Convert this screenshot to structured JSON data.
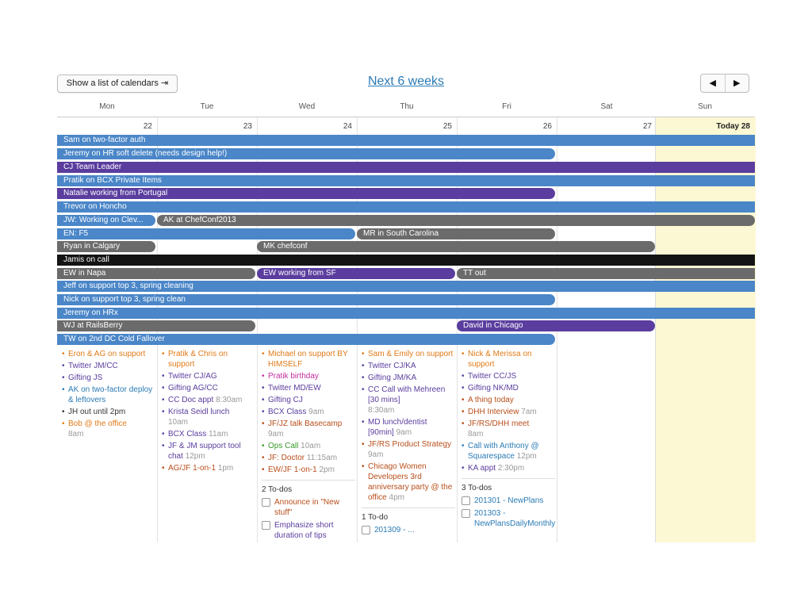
{
  "toolbar": {
    "calendars_button": "Show a list of calendars ⇥",
    "title": "Next 6 weeks",
    "prev": "◀",
    "next": "▶"
  },
  "days": [
    "Mon",
    "Tue",
    "Wed",
    "Thu",
    "Fri",
    "Sat",
    "Sun"
  ],
  "dates": [
    "22",
    "23",
    "24",
    "25",
    "26",
    "27",
    "Today 28"
  ],
  "events": [
    {
      "label": "Sam on two-factor auth",
      "color": "blue"
    },
    {
      "label": "Jeremy on HR soft delete (needs design help!)",
      "color": "blue"
    },
    {
      "label": "CJ Team Leader",
      "color": "purple"
    },
    {
      "label": "Pratik on BCX Private Items",
      "color": "blue"
    },
    {
      "label": "Natalie working from Portugal",
      "color": "purple"
    },
    {
      "label": "Trevor on Honcho",
      "color": "blue"
    },
    {
      "label": "JW: Working on Clev...",
      "color": "blue"
    },
    {
      "label": "AK at ChefConf2013",
      "color": "gray"
    },
    {
      "label": "EN: F5",
      "color": "blue"
    },
    {
      "label": "MR in South Carolina",
      "color": "gray"
    },
    {
      "label": "Ryan in Calgary",
      "color": "gray"
    },
    {
      "label": "MK chefconf",
      "color": "gray"
    },
    {
      "label": "Jamis on call",
      "color": "black"
    },
    {
      "label": "EW in Napa",
      "color": "gray"
    },
    {
      "label": "EW working from SF",
      "color": "purple"
    },
    {
      "label": "TT out",
      "color": "gray"
    },
    {
      "label": "Jeff on support top 3, spring cleaning",
      "color": "blue"
    },
    {
      "label": "Nick on support top 3, spring clean",
      "color": "blue"
    },
    {
      "label": "Jeremy on HRx",
      "color": "blue"
    },
    {
      "label": "WJ at RailsBerry",
      "color": "gray"
    },
    {
      "label": "David in Chicago",
      "color": "purple"
    },
    {
      "label": "TW on 2nd DC Cold Fallover",
      "color": "blue"
    }
  ],
  "mon_items": [
    {
      "t": "Eron & AG on support",
      "time": "",
      "color": "orange"
    },
    {
      "t": "Twitter JM/CC",
      "time": "",
      "color": "purple"
    },
    {
      "t": "Gifting JS",
      "time": "",
      "color": "purple"
    },
    {
      "t": "AK on two-factor deploy & leftovers",
      "time": "",
      "color": "blue"
    },
    {
      "t": "JH out until 2pm",
      "time": "",
      "color": "dark"
    },
    {
      "t": "Bob @ the office",
      "time": "8am",
      "color": "orange"
    }
  ],
  "tue_items": [
    {
      "t": "Pratik & Chris on support",
      "time": "",
      "color": "orange"
    },
    {
      "t": "Twitter CJ/AG",
      "time": "",
      "color": "purple"
    },
    {
      "t": "Gifting AG/CC",
      "time": "",
      "color": "purple"
    },
    {
      "t": "CC Doc appt",
      "time": "8:30am",
      "color": "purple"
    },
    {
      "t": "Krista Seidl lunch",
      "time": "10am",
      "color": "purple"
    },
    {
      "t": "BCX Class",
      "time": "11am",
      "color": "purple"
    },
    {
      "t": "JF & JM support tool chat",
      "time": "12pm",
      "color": "purple"
    },
    {
      "t": "AG/JF 1-on-1",
      "time": "1pm",
      "color": "rust"
    }
  ],
  "wed_items": [
    {
      "t": "Michael on support BY HIMSELF",
      "time": "",
      "color": "orange"
    },
    {
      "t": "Pratik birthday",
      "time": "",
      "color": "pink"
    },
    {
      "t": "Twitter MD/EW",
      "time": "",
      "color": "purple"
    },
    {
      "t": "Gifting CJ",
      "time": "",
      "color": "purple"
    },
    {
      "t": "BCX Class",
      "time": "9am",
      "color": "purple"
    },
    {
      "t": "JF/JZ talk Basecamp",
      "time": "9am",
      "color": "rust"
    },
    {
      "t": "Ops Call",
      "time": "10am",
      "color": "green"
    },
    {
      "t": "JF: Doctor",
      "time": "11:15am",
      "color": "rust"
    },
    {
      "t": "EW/JF 1-on-1",
      "time": "2pm",
      "color": "rust"
    }
  ],
  "wed_todos": {
    "header": "2 To-dos",
    "items": [
      "Announce in \"New stuff\"",
      "Emphasize short duration of tips"
    ]
  },
  "thu_items": [
    {
      "t": "Sam & Emily on support",
      "time": "",
      "color": "orange"
    },
    {
      "t": "Twitter CJ/KA",
      "time": "",
      "color": "purple"
    },
    {
      "t": "Gifting JM/KA",
      "time": "",
      "color": "purple"
    },
    {
      "t": "CC Call with Mehreen [30 mins]",
      "time": "8:30am",
      "color": "purple"
    },
    {
      "t": "MD lunch/dentist [90min]",
      "time": "9am",
      "color": "purple"
    },
    {
      "t": "JF/RS Product Strategy",
      "time": "9am",
      "color": "rust"
    },
    {
      "t": "Chicago Women Developers 3rd anniversary party @ the office",
      "time": "4pm",
      "color": "rust"
    }
  ],
  "thu_todos": {
    "header": "1 To-do",
    "items": [
      "201309 - ..."
    ]
  },
  "fri_items": [
    {
      "t": "Nick & Merissa on support",
      "time": "",
      "color": "orange"
    },
    {
      "t": "Twitter CC/JS",
      "time": "",
      "color": "purple"
    },
    {
      "t": "Gifting NK/MD",
      "time": "",
      "color": "purple"
    },
    {
      "t": "A thing today",
      "time": "",
      "color": "rust"
    },
    {
      "t": "DHH Interview",
      "time": "7am",
      "color": "rust"
    },
    {
      "t": "JF/RS/DHH meet",
      "time": "8am",
      "color": "rust"
    },
    {
      "t": "Call with Anthony @ Squarespace",
      "time": "12pm",
      "color": "blue"
    },
    {
      "t": "KA appt",
      "time": "2:30pm",
      "color": "purple"
    }
  ],
  "fri_todos": {
    "header": "3 To-dos",
    "items": [
      "201301 - NewPlans",
      "201303 - NewPlansDailyMonthly"
    ]
  }
}
